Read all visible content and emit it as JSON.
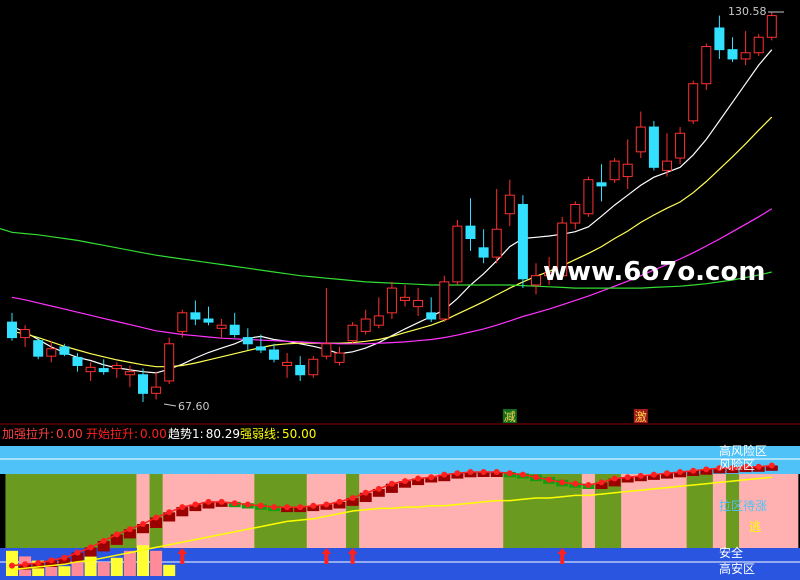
{
  "watermark": "www.6o7o.com",
  "main_chart": {
    "price_high_label": "130.58",
    "price_low_label": "67.60",
    "markers": [
      {
        "text": "减",
        "index": 38,
        "color": "#ffd24a",
        "bg": "#0f6b1e"
      },
      {
        "text": "激",
        "index": 48,
        "color": "#ffd24a",
        "bg": "#a11a1a"
      }
    ]
  },
  "indicator_bar": {
    "items": [
      {
        "label": "加强拉升:",
        "value": "0.00",
        "color": "#ff4040"
      },
      {
        "label": "开始拉升:",
        "value": "0.00",
        "color": "#ff2020"
      },
      {
        "label": "趋势1:",
        "value": "80.29",
        "color": "#ffffff"
      },
      {
        "label": "强弱线:",
        "value": "50.00",
        "color": "#ffff00"
      }
    ]
  },
  "zones": {
    "high_risk": "高风险区",
    "risk": "风险区",
    "pull_watch": "拉区待涨",
    "safe": "安全",
    "high_safe": "高安区",
    "flee": "逃"
  },
  "colors": {
    "up": "#ff3030",
    "down": "#33e0ff",
    "ma_fast": "#ffffff",
    "ma_mid": "#ffff55",
    "ma_slow": "#ff33ff",
    "ma_long": "#33dd33",
    "panel_cyan": "#4fc3f7",
    "panel_blue": "#2955e0",
    "panel_green": "#6a9a1f",
    "panel_pink": "#ffb0b0"
  },
  "chart_data": {
    "type": "candlestick",
    "series": [
      {
        "values": [
          [
            80.5,
            82.0,
            77.5,
            78.0
          ],
          [
            78.0,
            80.0,
            76.5,
            79.3
          ],
          [
            77.5,
            78.0,
            74.5,
            75.0
          ],
          [
            75.0,
            77.5,
            74.0,
            76.2
          ],
          [
            76.5,
            77.0,
            75.0,
            75.3
          ],
          [
            74.8,
            75.5,
            72.5,
            73.5
          ],
          [
            72.5,
            74.0,
            71.0,
            73.2
          ],
          [
            73.0,
            74.5,
            72.0,
            72.5
          ],
          [
            73.0,
            74.0,
            71.5,
            73.5
          ],
          [
            72.0,
            73.5,
            70.0,
            72.5
          ],
          [
            72.0,
            73.0,
            67.6,
            69.0
          ],
          [
            69.0,
            72.5,
            68.0,
            70.0
          ],
          [
            71.0,
            78.0,
            70.5,
            77.0
          ],
          [
            79.0,
            82.5,
            78.0,
            82.0
          ],
          [
            82.0,
            84.0,
            80.0,
            81.0
          ],
          [
            81.0,
            83.0,
            80.0,
            80.5
          ],
          [
            79.5,
            81.0,
            78.0,
            80.0
          ],
          [
            80.0,
            82.0,
            78.0,
            78.5
          ],
          [
            78.0,
            79.5,
            76.0,
            77.0
          ],
          [
            76.5,
            78.5,
            75.5,
            76.0
          ],
          [
            76.0,
            77.0,
            74.0,
            74.5
          ],
          [
            73.5,
            75.5,
            71.5,
            74.0
          ],
          [
            73.5,
            75.0,
            71.0,
            72.0
          ],
          [
            72.0,
            75.0,
            71.5,
            74.5
          ],
          [
            75.0,
            86.0,
            74.5,
            77.0
          ],
          [
            74.0,
            76.5,
            73.5,
            75.5
          ],
          [
            77.5,
            80.5,
            77.0,
            80.0
          ],
          [
            79.0,
            82.5,
            78.5,
            81.0
          ],
          [
            80.0,
            84.5,
            79.5,
            81.5
          ],
          [
            82.0,
            87.0,
            81.0,
            86.0
          ],
          [
            84.0,
            86.5,
            83.0,
            84.5
          ],
          [
            83.0,
            86.0,
            81.5,
            84.0
          ],
          [
            82.0,
            84.5,
            80.5,
            81.0
          ],
          [
            81.0,
            88.0,
            80.5,
            87.0
          ],
          [
            87.0,
            97.0,
            86.5,
            96.0
          ],
          [
            96.0,
            100.5,
            92.0,
            94.0
          ],
          [
            92.5,
            95.5,
            90.0,
            91.0
          ],
          [
            91.0,
            102.0,
            90.0,
            95.5
          ],
          [
            98.0,
            103.5,
            96.0,
            101.0
          ],
          [
            99.5,
            101.0,
            86.0,
            87.5
          ],
          [
            86.5,
            90.0,
            85.0,
            88.0
          ],
          [
            88.0,
            91.0,
            86.5,
            88.5
          ],
          [
            88.0,
            97.5,
            87.5,
            96.5
          ],
          [
            96.5,
            100.0,
            95.5,
            99.5
          ],
          [
            98.0,
            104.0,
            97.5,
            103.5
          ],
          [
            103.0,
            106.0,
            100.0,
            102.5
          ],
          [
            103.5,
            107.0,
            103.0,
            106.5
          ],
          [
            104.0,
            110.0,
            102.0,
            106.0
          ],
          [
            108.0,
            114.5,
            107.0,
            112.0
          ],
          [
            112.0,
            113.0,
            105.0,
            105.5
          ],
          [
            105.0,
            111.0,
            104.0,
            106.5
          ],
          [
            107.0,
            112.0,
            106.0,
            111.0
          ],
          [
            113.0,
            119.5,
            112.5,
            119.0
          ],
          [
            119.0,
            125.5,
            118.0,
            125.0
          ],
          [
            128.0,
            130.0,
            123.0,
            124.5
          ],
          [
            124.5,
            126.5,
            122.5,
            123.0
          ],
          [
            123.0,
            127.5,
            122.0,
            124.0
          ],
          [
            124.0,
            127.0,
            123.5,
            126.5
          ],
          [
            126.5,
            130.58,
            126.0,
            130.0
          ]
        ]
      }
    ],
    "moving_averages": [
      {
        "key": "ma_fast",
        "values": [
          79.8,
          78.9,
          77.7,
          76.5,
          75.6,
          74.8,
          74.3,
          73.6,
          73.1,
          72.8,
          72.5,
          72.3,
          72.9,
          73.7,
          74.7,
          75.6,
          76.3,
          77.0,
          77.9,
          78.2,
          77.7,
          77.4,
          77.0,
          76.6,
          76.1,
          75.4,
          75.7,
          76.3,
          77.2,
          78.3,
          79.4,
          80.4,
          81.4,
          82.5,
          84.3,
          86.5,
          88.3,
          90.4,
          92.7,
          94.0,
          94.2,
          94.4,
          94.7,
          95.1,
          95.9,
          97.6,
          99.4,
          101.0,
          102.6,
          103.9,
          104.7,
          105.5,
          107.5,
          110.0,
          113.0,
          116.0,
          119.0,
          122.0,
          124.5
        ]
      },
      {
        "key": "ma_mid",
        "values": [
          79.0,
          78.6,
          78.0,
          77.3,
          76.6,
          76.0,
          75.4,
          74.9,
          74.4,
          74.0,
          73.6,
          73.3,
          73.3,
          73.5,
          73.9,
          74.4,
          74.9,
          75.4,
          75.9,
          76.4,
          76.8,
          77.0,
          77.1,
          77.1,
          77.1,
          77.1,
          77.2,
          77.4,
          77.7,
          78.2,
          78.8,
          79.4,
          80.0,
          80.8,
          81.8,
          82.8,
          83.8,
          84.9,
          86.0,
          87.0,
          87.9,
          88.7,
          89.6,
          90.6,
          91.6,
          92.7,
          94.0,
          95.2,
          96.6,
          97.8,
          98.9,
          99.9,
          101.4,
          103.2,
          105.2,
          107.2,
          109.3,
          111.5,
          113.6
        ]
      },
      {
        "key": "ma_slow",
        "values": [
          84.5,
          84.1,
          83.6,
          83.1,
          82.6,
          82.1,
          81.6,
          81.1,
          80.6,
          80.1,
          79.6,
          79.1,
          78.8,
          78.5,
          78.3,
          78.1,
          77.9,
          77.8,
          77.7,
          77.6,
          77.5,
          77.4,
          77.3,
          77.2,
          77.1,
          77.0,
          77.0,
          77.0,
          77.1,
          77.2,
          77.3,
          77.5,
          77.7,
          78.0,
          78.4,
          78.9,
          79.4,
          80.0,
          80.7,
          81.4,
          82.0,
          82.6,
          83.3,
          84.0,
          84.7,
          85.5,
          86.3,
          87.1,
          88.0,
          88.9,
          89.8,
          90.7,
          91.7,
          92.8,
          93.9,
          95.1,
          96.3,
          97.5,
          98.8
        ]
      },
      {
        "key": "ma_long",
        "values": [
          95.0,
          94.8,
          94.6,
          94.3,
          94.0,
          93.7,
          93.3,
          92.9,
          92.5,
          92.1,
          91.7,
          91.3,
          91.0,
          90.7,
          90.4,
          90.1,
          89.8,
          89.5,
          89.2,
          88.9,
          88.6,
          88.3,
          88.0,
          87.8,
          87.6,
          87.4,
          87.2,
          87.0,
          86.9,
          86.8,
          86.7,
          86.6,
          86.5,
          86.5,
          86.5,
          86.5,
          86.5,
          86.5,
          86.5,
          86.4,
          86.3,
          86.2,
          86.1,
          86.0,
          86.0,
          86.0,
          86.0,
          86.0,
          86.0,
          86.1,
          86.2,
          86.3,
          86.5,
          86.7,
          87.0,
          87.3,
          87.7,
          88.1,
          88.6
        ]
      }
    ],
    "ylim": [
      67.6,
      130.58
    ],
    "sub_chart": {
      "type": "heatmap",
      "trend_line": [
        8,
        9,
        10,
        12,
        14,
        18,
        22,
        27,
        32,
        36,
        40,
        45,
        49,
        53,
        55,
        57,
        57,
        56,
        55,
        54,
        53,
        53,
        53,
        54,
        55,
        57,
        60,
        64,
        67,
        71,
        73,
        75,
        76,
        78,
        79,
        80,
        80,
        80,
        79,
        78,
        76,
        74,
        72,
        71,
        70,
        72,
        75,
        76,
        77,
        78,
        79,
        80,
        81,
        82,
        83,
        83,
        84,
        84,
        85
      ],
      "strength_line": [
        5,
        6,
        7,
        8,
        9,
        11,
        12,
        14,
        16,
        18,
        20,
        22,
        24,
        26,
        28,
        30,
        32,
        34,
        36,
        38,
        40,
        42,
        43,
        44,
        46,
        48,
        50,
        51,
        52,
        52,
        53,
        53,
        54,
        54,
        55,
        56,
        57,
        58,
        58,
        59,
        60,
        60,
        61,
        62,
        62,
        63,
        64,
        65,
        66,
        67,
        68,
        69,
        70,
        71,
        72,
        73,
        74,
        75,
        76
      ],
      "low_bars": [
        18,
        14,
        11,
        9,
        7,
        12,
        14,
        10,
        13,
        18,
        22,
        18,
        8,
        0,
        0,
        0,
        0,
        0,
        0,
        0,
        0,
        0,
        0,
        0,
        0,
        0,
        0,
        0,
        0,
        0,
        0,
        0,
        0,
        0,
        0,
        0,
        0,
        0,
        0,
        0,
        0,
        0,
        0,
        0,
        0,
        0,
        0,
        0,
        0,
        0,
        0,
        0,
        0,
        0,
        0,
        0,
        0,
        0,
        0
      ],
      "arrows": [
        13,
        24,
        26,
        42
      ]
    }
  }
}
